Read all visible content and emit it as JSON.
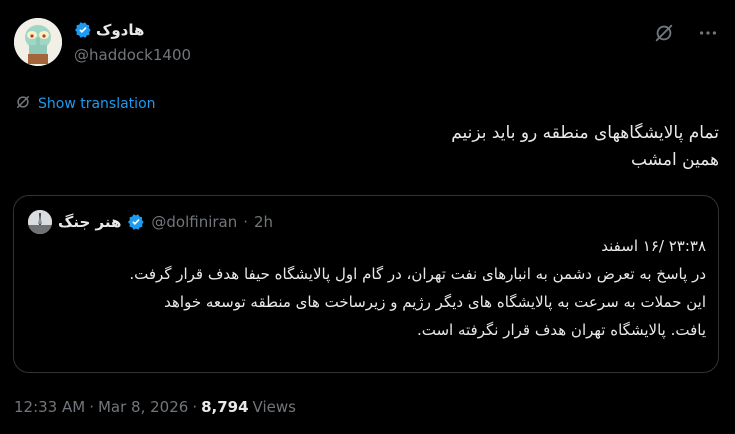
{
  "author": {
    "display_name": "هادوک",
    "handle": "@haddock1400",
    "verified": true
  },
  "translate_label": "Show translation",
  "tweet_lines": [
    "تمام پالایشگاههای منطقه رو باید بزنیم",
    "همین امشب"
  ],
  "quote": {
    "display_name": "هنر جنگ",
    "handle": "@dolfiniran",
    "separator": "·",
    "time": "2h",
    "lines": [
      "۲۳:۳۸ /۱۶ اسفند",
      "در پاسخ به تعرض دشمن به انبارهای نفت تهران، در گام اول پالایشگاه حیفا هدف قرار گرفت.",
      "این حملات به سرعت به پالایشگاه های دیگر رژیم و زیرساخت های منطقه توسعه خواهد",
      "یافت. پالایشگاه تهران هدف قرار نگرفته است."
    ]
  },
  "meta": {
    "time": "12:33 AM",
    "separator": "·",
    "date": "Mar 8, 2026",
    "separator2": "·",
    "views_count": "8,794",
    "views_label": "Views"
  },
  "colors": {
    "background": "#000000",
    "text": "#e7e9ea",
    "muted": "#71767b",
    "accent": "#1d9bf0",
    "border": "#2f3336"
  },
  "icons": {
    "verified": "verified-badge-icon",
    "grok": "grok-icon",
    "more": "more-icon",
    "translate": "translate-icon"
  }
}
